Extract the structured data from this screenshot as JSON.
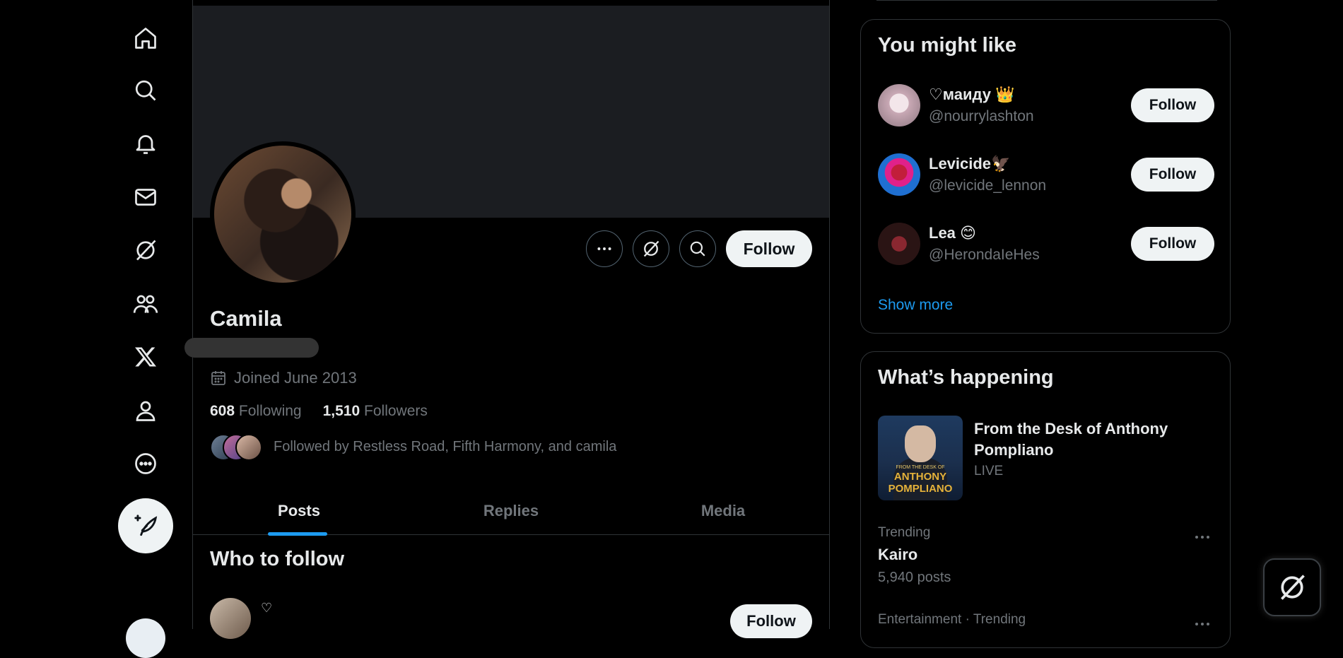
{
  "nav": {
    "items": [
      "home",
      "explore",
      "notifications",
      "messages",
      "grok",
      "communities",
      "premium",
      "profile",
      "more"
    ]
  },
  "profile": {
    "name": "Camila",
    "joined": "Joined June 2013",
    "following_count": "608",
    "following_label": "Following",
    "followers_count": "1,510",
    "followers_label": "Followers",
    "followed_by": "Followed by Restless Road, Fifth Harmony, and camila",
    "follow_label": "Follow"
  },
  "tabs": [
    "Posts",
    "Replies",
    "Media"
  ],
  "who_to_follow": {
    "title": "Who to follow",
    "first_name": "♡",
    "follow_label": "Follow"
  },
  "you_might_like": {
    "title": "You might like",
    "users": [
      {
        "name": "♡маиду 👑",
        "handle": "@nourrylashton",
        "follow": "Follow"
      },
      {
        "name": "Levicide🦅",
        "handle": "@levicide_lennon",
        "follow": "Follow"
      },
      {
        "name": "Lea 😊",
        "handle": "@HerondaIeHes",
        "follow": "Follow"
      }
    ],
    "show_more": "Show more"
  },
  "whats_happening": {
    "title": "What’s happening",
    "event": {
      "title": "From the Desk of Anthony Pompliano",
      "status": "LIVE",
      "image_line1": "FROM THE DESK OF",
      "image_line2": "ANTHONY POMPLIANO"
    },
    "trends": [
      {
        "context": "Trending",
        "name": "Kairo",
        "count": "5,940 posts"
      },
      {
        "context": "Entertainment · Trending",
        "name": "",
        "count": ""
      }
    ]
  },
  "colors": {
    "background": "#000000",
    "accent": "#1d9bf0",
    "muted_text": "#71767b",
    "button_bg": "#eff3f4"
  }
}
